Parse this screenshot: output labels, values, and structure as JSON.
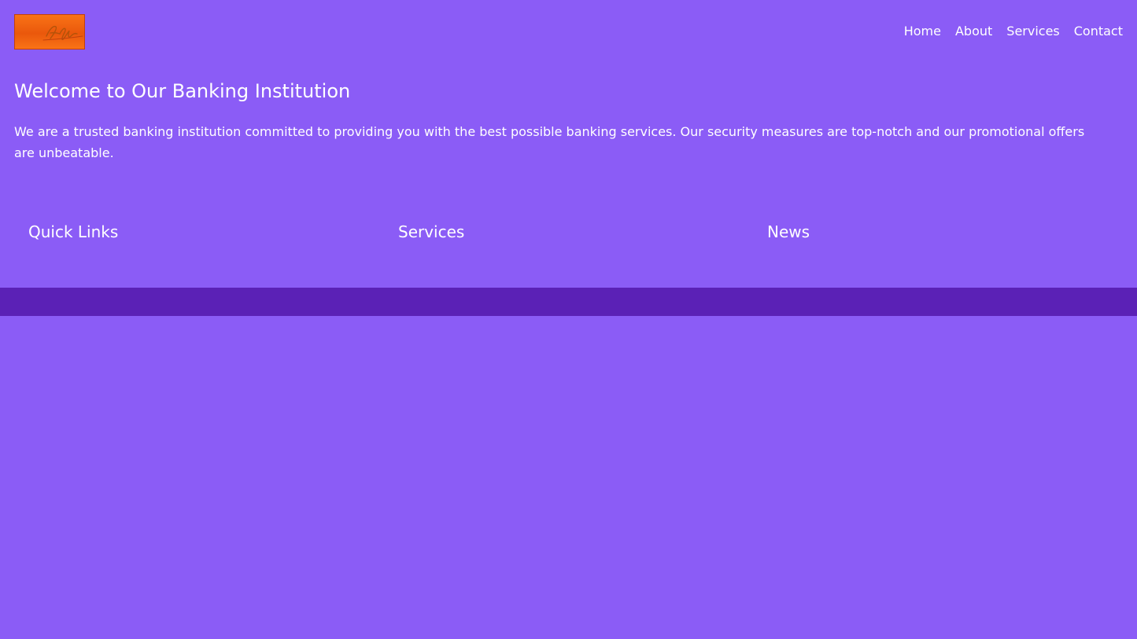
{
  "header": {
    "logo_signature": "Ayle",
    "nav": [
      {
        "label": "Home"
      },
      {
        "label": "About"
      },
      {
        "label": "Services"
      },
      {
        "label": "Contact"
      }
    ]
  },
  "hero": {
    "title": "Welcome to Our Banking Institution",
    "text": "We are a trusted banking institution committed to providing you with the best possible banking services. Our security measures are top-notch and our promotional offers are unbeatable."
  },
  "columns": [
    {
      "heading": "Quick Links"
    },
    {
      "heading": "Services"
    },
    {
      "heading": "News"
    }
  ],
  "colors": {
    "background": "#8b5cf6",
    "footer": "#5b21b6",
    "text": "#ffffff",
    "logo": "#f97316"
  }
}
